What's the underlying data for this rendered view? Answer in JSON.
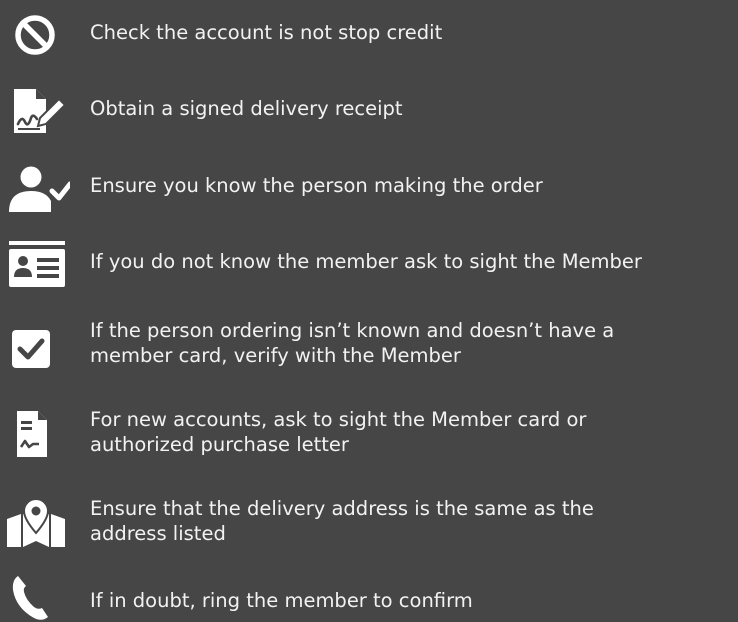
{
  "checklist": [
    {
      "icon": "prohibited-icon",
      "lines": [
        "Check the account is not stop credit"
      ]
    },
    {
      "icon": "signed-document-icon",
      "lines": [
        "Obtain a signed delivery receipt"
      ]
    },
    {
      "icon": "user-check-icon",
      "lines": [
        "Ensure you know the person making the order"
      ]
    },
    {
      "icon": "id-card-icon",
      "lines": [
        "If you do not know the member ask to sight the Member"
      ]
    },
    {
      "icon": "checkbox-checked-icon",
      "lines": [
        "If the person ordering isn’t known and doesn’t have a",
        "member card, verify with the Member"
      ]
    },
    {
      "icon": "document-signature-icon",
      "lines": [
        "For new accounts, ask to sight the Member card or",
        "authorized purchase letter"
      ]
    },
    {
      "icon": "map-location-icon",
      "lines": [
        "Ensure that the delivery address is the same as the",
        "address listed"
      ]
    },
    {
      "icon": "phone-icon",
      "lines": [
        "If in doubt, ring the member to confirm"
      ]
    }
  ]
}
